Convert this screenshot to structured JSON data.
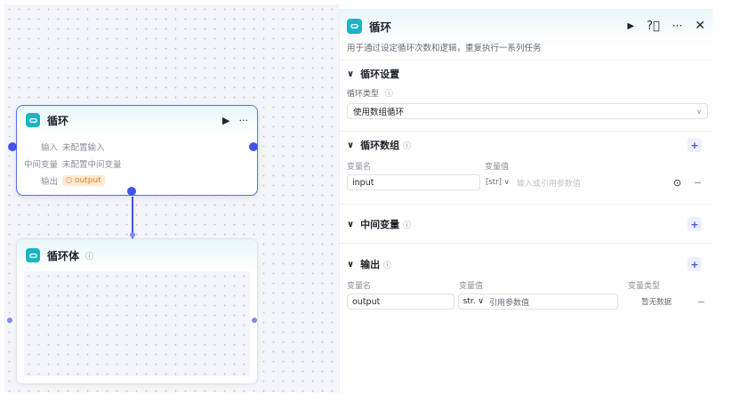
{
  "loop_node": {
    "title": "循环",
    "rows": [
      {
        "key": "输入",
        "value": "未配置输入"
      },
      {
        "key": "中间变量",
        "value": "未配置中间变量"
      },
      {
        "key": "输出",
        "tag": "output"
      }
    ],
    "run_icon": "play-icon",
    "more_icon": "more-icon"
  },
  "body_node": {
    "title": "循环体",
    "info_icon": "info-icon"
  },
  "panel": {
    "title": "循环",
    "description": "用于通过设定循环次数和逻辑，重复执行一系列任务",
    "sections": {
      "settings": {
        "title": "循环设置",
        "type_label": "循环类型",
        "type_value": "使用数组循环"
      },
      "array": {
        "title": "循环数组",
        "col_name": "变量名",
        "col_value": "变量值",
        "row": {
          "name": "input",
          "type_label": "[str]",
          "placeholder": "输入或引用参数值"
        }
      },
      "intermediate": {
        "title": "中间变量"
      },
      "output": {
        "title": "输出",
        "col_name": "变量名",
        "col_value": "变量值",
        "col_type": "变量类型",
        "row": {
          "name": "output",
          "type_label": "str.",
          "placeholder": "引用参数值",
          "var_type": "暂无数据"
        }
      }
    }
  },
  "colors": {
    "accent": "#4353e8",
    "node_icon": "#18b6c4",
    "tag_bg": "#fde9d4",
    "tag_fg": "#d8822a"
  }
}
